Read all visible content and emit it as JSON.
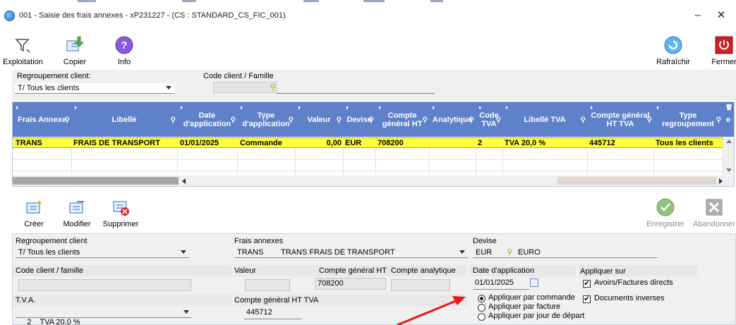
{
  "window": {
    "title": "001 - Saisie des frais annexes - xP231227 - (CS : STANDARD_CS_FIC_001)",
    "minimize": "–",
    "maximize": "☐",
    "close": "✕"
  },
  "toolbar": {
    "exploitation": "Exploitation",
    "copier": "Copier",
    "info": "Info",
    "rafraichir": "Rafraîchir",
    "fermer": "Fermer"
  },
  "filter": {
    "regroupement_label": "Regroupement client:",
    "regroupement_value": "T/ Tous les clients",
    "code_client_label": "Code client / Famille",
    "code_client_value": ""
  },
  "grid": {
    "columns": [
      "Frais Annexe",
      "Libellé",
      "Date d'application",
      "Type d'application",
      "Valeur",
      "Devise",
      "Compte général HT",
      "Analytique",
      "Code TVA",
      "Libellé TVA",
      "Compte général HT TVA",
      "Type regroupement",
      "e"
    ],
    "rows": [
      {
        "frais": "TRANS",
        "libelle": "FRAIS DE TRANSPORT",
        "date": "01/01/2025",
        "type": "Commande",
        "valeur": "0,00",
        "devise": "EUR",
        "compte": "708200",
        "analytique": "",
        "code_tva": "2",
        "libelle_tva": "TVA 20,0 %",
        "compte_tva": "445712",
        "regroupement": "Tous les clients"
      }
    ]
  },
  "actions": {
    "creer": "Créer",
    "modifier": "Modifier",
    "supprimer": "Supprimer",
    "enregistrer": "Enregistrer",
    "abandonner": "Abandonner"
  },
  "form": {
    "regroupement_label": "Regroupement client",
    "regroupement_value": "T/ Tous les clients",
    "frais_label": "Frais annexes",
    "frais_code": "TRANS",
    "frais_libelle": "TRANS FRAIS DE TRANSPORT",
    "devise_label": "Devise",
    "devise_code": "EUR",
    "devise_libelle": "EURO",
    "code_client_label": "Code client / famille",
    "valeur_label": "Valeur",
    "compte_ht_label": "Compte général HT",
    "compte_ht_value": "708200",
    "compte_analytique_label": "Compte analytique",
    "date_label": "Date d'application",
    "date_value": "01/01/2025",
    "appliquer_sur_label": "Appliquer sur",
    "avoirs_label": "Avoirs/Factures directs",
    "avoirs_checked": true,
    "documents_label": "Documents inverses",
    "documents_checked": true,
    "tva_label": "T.V.A.",
    "tva_value": "2    TVA 20,0 %",
    "compte_tva_label": "Compte général HT TVA",
    "compte_tva_value": "445712",
    "radio_commande": "Appliquer par commande",
    "radio_facture": "Appliquer par facture",
    "radio_jour": "Appliquer par jour de départ",
    "radio_selected": "commande"
  },
  "colors": {
    "grid_header": "#5e81c9",
    "selected_row": "#ffff3a",
    "annotation_arrow": "#e81616"
  }
}
